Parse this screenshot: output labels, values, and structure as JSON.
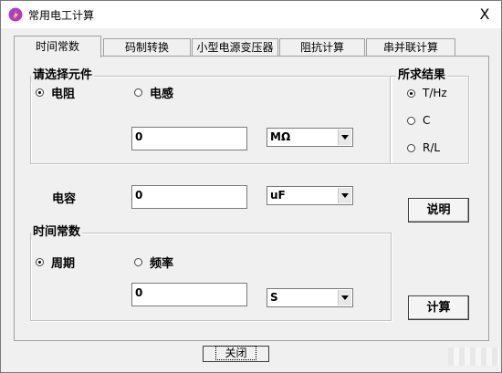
{
  "window": {
    "title": "常用电工计算",
    "close_glyph": "X"
  },
  "tabs": [
    {
      "label": "时间常数",
      "active": true
    },
    {
      "label": "码制转换",
      "active": false
    },
    {
      "label": "小型电源变压器",
      "active": false
    },
    {
      "label": "阻抗计算",
      "active": false
    },
    {
      "label": "串并联计算",
      "active": false
    }
  ],
  "component_group": {
    "title": "请选择元件",
    "options": [
      {
        "label": "电阻",
        "selected": true
      },
      {
        "label": "电感",
        "selected": false
      }
    ],
    "value": "0",
    "unit": "MΩ"
  },
  "result_group": {
    "title": "所求结果",
    "options": [
      {
        "label": "T/Hz",
        "selected": true
      },
      {
        "label": "C",
        "selected": false
      },
      {
        "label": "R/L",
        "selected": false
      }
    ]
  },
  "capacitance": {
    "label": "电容",
    "value": "0",
    "unit": "uF"
  },
  "time_constant_group": {
    "title": "时间常数",
    "options": [
      {
        "label": "周期",
        "selected": true
      },
      {
        "label": "频率",
        "selected": false
      }
    ],
    "value": "0",
    "unit": "S"
  },
  "buttons": {
    "help": "说明",
    "calculate": "计算",
    "close": "关闭"
  },
  "colors": {
    "window_bg": "#f0f0f0",
    "titlebar_bg": "#ffffff",
    "icon_color": "#b23bc6"
  }
}
